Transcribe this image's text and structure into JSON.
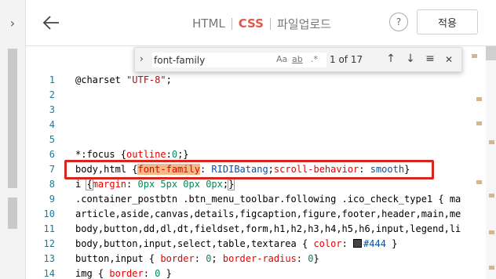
{
  "nav": {
    "rail_toggle_glyph": "›",
    "back_glyph": "←"
  },
  "tabs": [
    {
      "label": "HTML",
      "active": false
    },
    {
      "label": "CSS",
      "active": true
    },
    {
      "label": "파일업로드",
      "active": false
    }
  ],
  "help_label": "?",
  "apply_label": "적용",
  "find": {
    "value": "font-family",
    "opt_case": "Aa",
    "opt_word": "ab",
    "opt_regex": ".*",
    "count": "1 of 17",
    "prev": "↑",
    "next": "↓",
    "selection": "≡",
    "close": "✕"
  },
  "line_numbers": [
    "1",
    "2",
    "3",
    "4",
    "5",
    "6",
    "7",
    "8",
    "9",
    "10",
    "11",
    "12",
    "13",
    "14"
  ],
  "code": {
    "l1_kw": "@charset ",
    "l1_str": "\"UTF-8\"",
    "l1_end": ";",
    "l6_sel": "*:focus {",
    "l6_prop": "outline",
    "l6_colon": ":",
    "l6_num": "0",
    "l6_end": ";}",
    "l7_sel": "body,html {",
    "l7_prop1": "font-family",
    "l7_colon1": ": ",
    "l7_val1": "RIDIBatang",
    "l7_semi": ";",
    "l7_prop2": "scroll-behavior",
    "l7_colon2": ": ",
    "l7_val2": "smooth",
    "l7_end": "}",
    "l8_sel": "i ",
    "l8_brace": "{",
    "l8_prop": "margin",
    "l8_colon": ": ",
    "l8_val": "0px 5px 0px 0px",
    "l8_semi": ";",
    "l8_close": "}",
    "l9": ".container_postbtn .btn_menu_toolbar.following .ico_check_type1 { ma",
    "l10": "article,aside,canvas,details,figcaption,figure,footer,header,main,me",
    "l11": "body,button,dd,dl,dt,fieldset,form,h1,h2,h3,h4,h5,h6,input,legend,li",
    "l12_sel": "body,button,input,select,table,textarea { ",
    "l12_prop": "color",
    "l12_colon": ": ",
    "l12_val": "#444",
    "l12_end": " }",
    "l13_sel": "button,input { ",
    "l13_prop1": "border",
    "l13_colon1": ": ",
    "l13_num1": "0",
    "l13_semi": "; ",
    "l13_prop2": "border-radius",
    "l13_colon2": ": ",
    "l13_num2": "0",
    "l13_end": "}",
    "l14_sel": "img { ",
    "l14_prop": "border",
    "l14_colon": ": ",
    "l14_num": "0",
    "l14_end": " }"
  },
  "colors": {
    "accent": "#e3564a",
    "highlight_box": "#d7261e",
    "find_match": "#f6b985",
    "swatch": "#444444"
  }
}
